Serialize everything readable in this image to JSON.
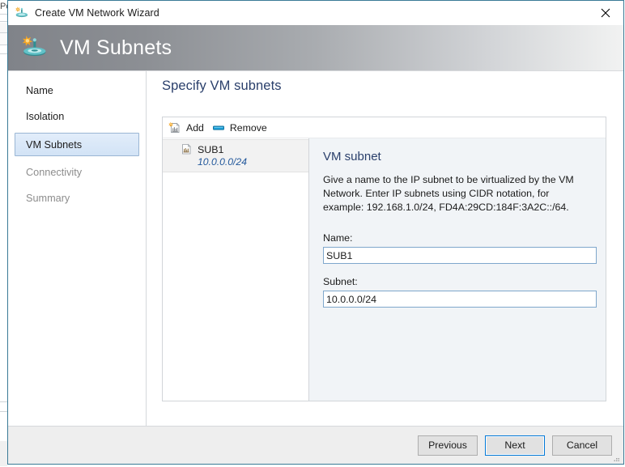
{
  "window": {
    "title": "Create VM Network Wizard",
    "title_icon": "vm-network-icon",
    "close_icon": "close-icon",
    "border_color": "#3a7a96"
  },
  "header": {
    "title": "VM Subnets",
    "icon": "vm-network-icon",
    "gradient_from": "#808389",
    "gradient_to": "#f1f2f2"
  },
  "sidebar": {
    "items": [
      {
        "label": "Name",
        "state": "enabled"
      },
      {
        "label": "Isolation",
        "state": "enabled"
      },
      {
        "label": "VM Subnets",
        "state": "selected"
      },
      {
        "label": "Connectivity",
        "state": "disabled"
      },
      {
        "label": "Summary",
        "state": "disabled"
      }
    ],
    "selected_bg": "#d2e3f6",
    "selected_border": "#9ab6d4"
  },
  "content": {
    "heading": "Specify VM subnets",
    "heading_color": "#2a3f6b"
  },
  "toolbar": {
    "add_label": "Add",
    "add_icon": "add-subnet-icon",
    "remove_label": "Remove",
    "remove_icon": "remove-icon"
  },
  "subnet_list": {
    "items": [
      {
        "name": "SUB1",
        "cidr": "10.0.0.0/24",
        "icon": "subnet-icon",
        "selected": true
      }
    ],
    "selected_bg": "#f2f2f2",
    "cidr_color": "#24599c"
  },
  "detail": {
    "heading": "VM subnet",
    "description": "Give a name to the IP subnet to be virtualized by the VM Network. Enter IP subnets using CIDR notation, for example: 192.168.1.0/24, FD4A:29CD:184F:3A2C::/64.",
    "name_label": "Name:",
    "name_value": "SUB1",
    "name_placeholder": "",
    "subnet_label": "Subnet:",
    "subnet_value": "10.0.0.0/24",
    "subnet_placeholder": "",
    "background": "#f1f4f7"
  },
  "footer": {
    "previous_label": "Previous",
    "next_label": "Next",
    "cancel_label": "Cancel",
    "default_button": "Next",
    "focus_color": "#0078d7"
  }
}
